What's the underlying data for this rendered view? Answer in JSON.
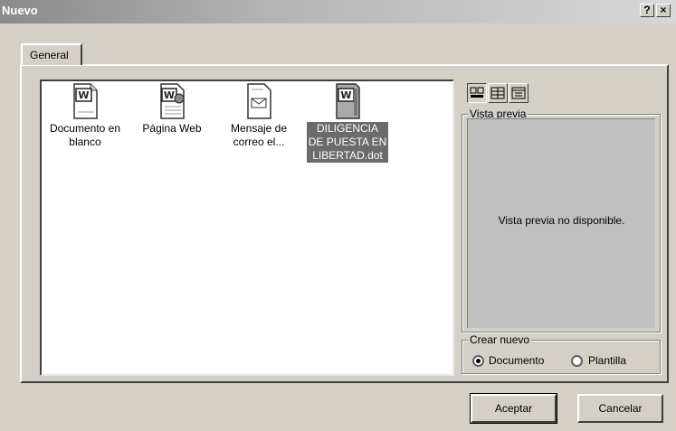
{
  "window": {
    "title": "Nuevo",
    "help_label": "?",
    "close_label": "×"
  },
  "tabs": [
    {
      "label": "General",
      "active": true
    }
  ],
  "files": [
    {
      "line1": "Documento en",
      "line2": "blanco",
      "line3": "",
      "icon": "word-document-icon",
      "selected": false
    },
    {
      "line1": "Página Web",
      "line2": "",
      "line3": "",
      "icon": "web-page-icon",
      "selected": false
    },
    {
      "line1": "Mensaje de",
      "line2": "correo el...",
      "line3": "",
      "icon": "email-message-icon",
      "selected": false
    },
    {
      "line1": "DILIGENCIA",
      "line2": "DE PUESTA EN",
      "line3": "LIBERTAD.dot",
      "icon": "word-template-icon",
      "selected": true
    }
  ],
  "view_buttons": [
    {
      "icon": "large-icons-view-icon",
      "active": true
    },
    {
      "icon": "list-view-icon",
      "active": false
    },
    {
      "icon": "details-view-icon",
      "active": false
    }
  ],
  "preview": {
    "legend": "Vista previa",
    "message": "Vista previa no disponible."
  },
  "create_new": {
    "legend": "Crear nuevo",
    "options": [
      {
        "label": "Documento",
        "checked": true
      },
      {
        "label": "Plantilla",
        "checked": false
      }
    ]
  },
  "buttons": {
    "ok_label": "Aceptar",
    "cancel_label": "Cancelar"
  },
  "colors": {
    "dialog_bg": "#d4d0c8",
    "selection_bg": "#6b6b6b",
    "preview_bg": "#c0c0c0"
  }
}
